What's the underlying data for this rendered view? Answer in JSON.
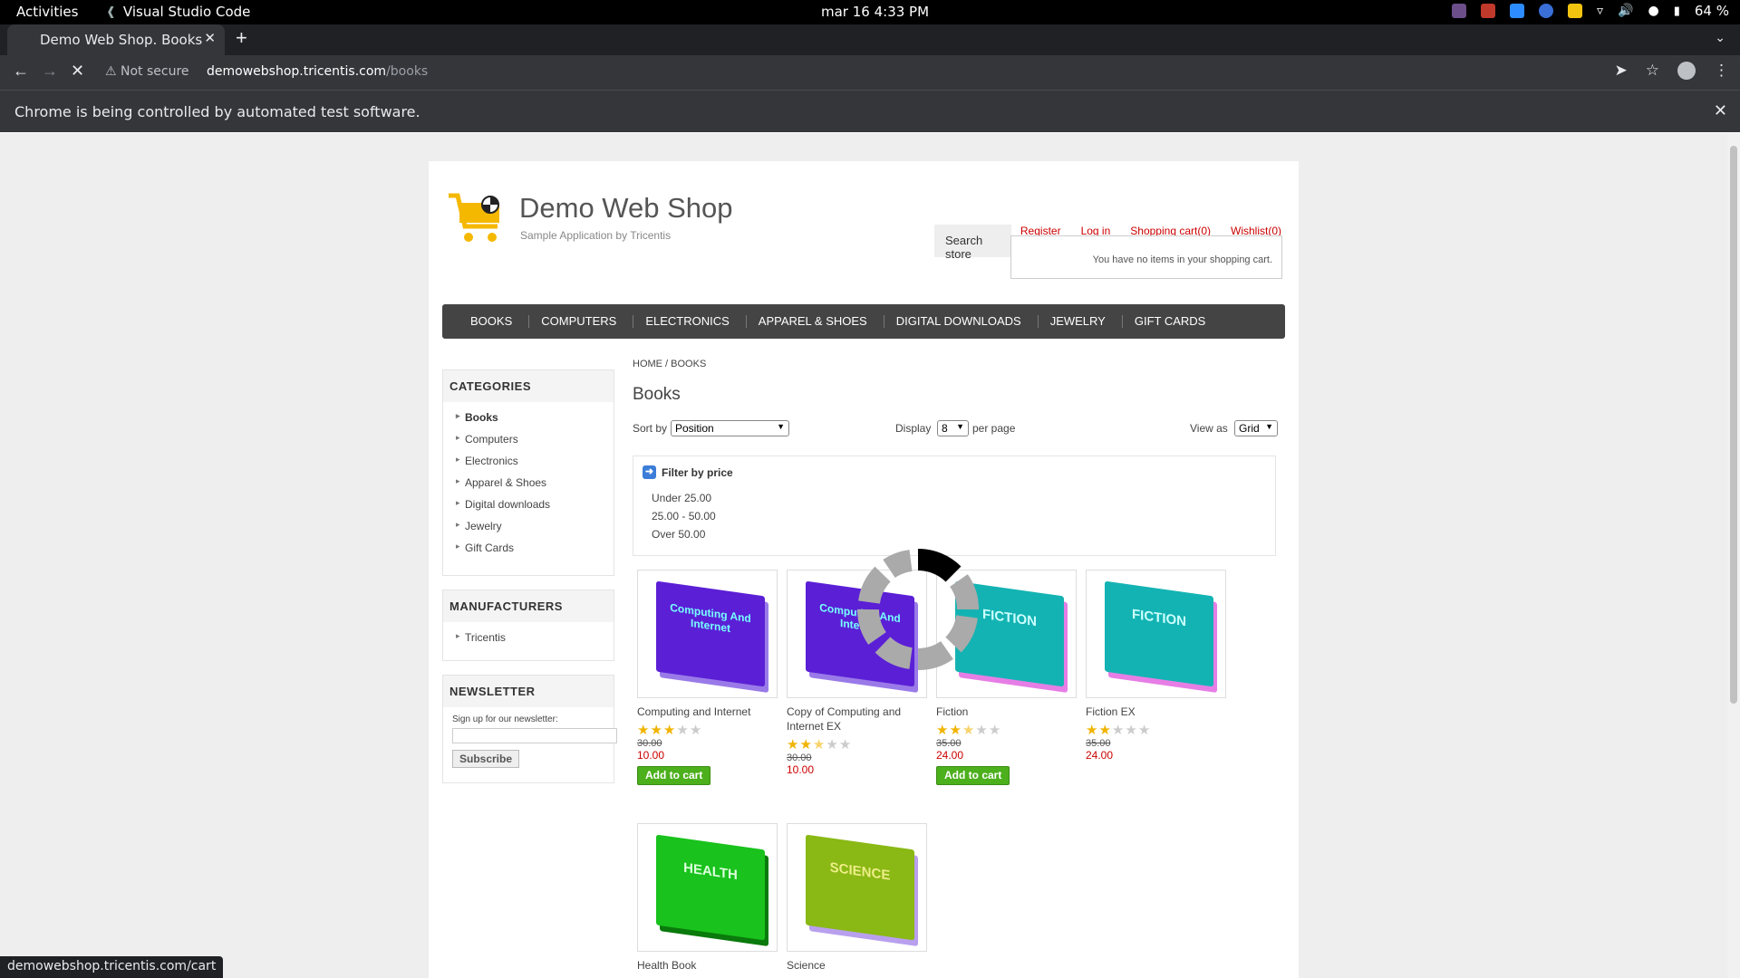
{
  "system_bar": {
    "activities": "Activities",
    "app_name": "Visual Studio Code",
    "clock": "mar 16  4:33 PM",
    "battery": "64 %"
  },
  "browser": {
    "tab_title": "Demo Web Shop. Books",
    "security_label": "Not secure",
    "url_host": "demowebshop.tricentis.com",
    "url_path": "/books",
    "infobar_message": "Chrome is being controlled by automated test software.",
    "status_url": "demowebshop.tricentis.com/cart"
  },
  "shop": {
    "logo_title": "Demo Web Shop",
    "logo_subtitle": "Sample Application by Tricentis",
    "header_links": {
      "register": "Register",
      "login": "Log in",
      "cart": "Shopping cart(0)",
      "wishlist": "Wishlist(0)"
    },
    "cart_flyout": "You have no items in your shopping cart.",
    "search_button": "Search store",
    "menu": [
      "BOOKS",
      "COMPUTERS",
      "ELECTRONICS",
      "APPAREL & SHOES",
      "DIGITAL DOWNLOADS",
      "JEWELRY",
      "GIFT CARDS"
    ],
    "categories": {
      "title": "CATEGORIES",
      "items": [
        "Books",
        "Computers",
        "Electronics",
        "Apparel & Shoes",
        "Digital downloads",
        "Jewelry",
        "Gift Cards"
      ]
    },
    "manufacturers": {
      "title": "MANUFACTURERS",
      "items": [
        "Tricentis"
      ]
    },
    "newsletter": {
      "title": "NEWSLETTER",
      "label": "Sign up for our newsletter:",
      "email_value": "",
      "button": "Subscribe"
    },
    "breadcrumb": "HOME / BOOKS",
    "page_title": "Books",
    "sort_label": "Sort by",
    "sort_value": "Position",
    "display_label": "Display",
    "display_value": "8",
    "per_page": "per page",
    "view_label": "View as",
    "view_value": "Grid",
    "filter": {
      "title": "Filter by price",
      "ranges": [
        "Under 25.00",
        "25.00 - 50.00",
        "Over 50.00"
      ]
    },
    "add_to_cart": "Add to cart",
    "products": [
      {
        "title": "Computing and Internet",
        "old_price": "30.00",
        "price": "10.00",
        "rating": 3,
        "add_to_cart": true,
        "cover_color": "#5b1fd6",
        "cover_text": "Computing And Internet"
      },
      {
        "title": "Copy of Computing and Internet EX",
        "old_price": "30.00",
        "price": "10.00",
        "rating": 2.5,
        "add_to_cart": false,
        "cover_color": "#5b1fd6",
        "cover_text": "Computing And Internet"
      },
      {
        "title": "Fiction",
        "old_price": "35.00",
        "price": "24.00",
        "rating": 2.5,
        "add_to_cart": true,
        "cover_color": "#14b3b3",
        "cover_text": "FICTION"
      },
      {
        "title": "Fiction EX",
        "old_price": "35.00",
        "price": "24.00",
        "rating": 2,
        "add_to_cart": false,
        "cover_color": "#14b3b3",
        "cover_text": "FICTION"
      },
      {
        "title": "Health Book",
        "cover_color": "#19c21c",
        "cover_text": "HEALTH"
      },
      {
        "title": "Science",
        "cover_color": "#8ab814",
        "cover_text": "SCIENCE"
      }
    ]
  }
}
